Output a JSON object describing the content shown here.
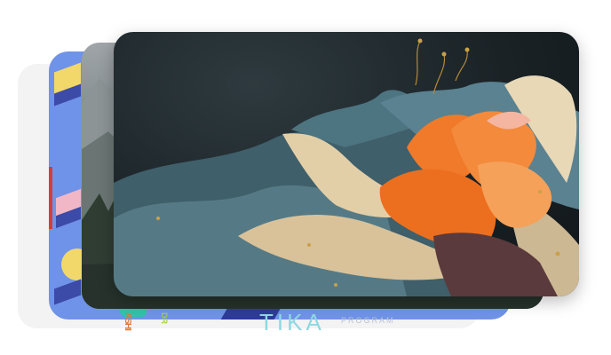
{
  "poster": {
    "bottom_word": "TIKA",
    "caption": "PROGRAM",
    "vertical_letters": "ASHI",
    "side_letters": "DR"
  },
  "colors": {
    "blue_card": "#6f93e8",
    "gray_card": "#f3f3f3",
    "art_background": "#1a2226",
    "flower_orange": "#f07a2a",
    "petal_teal": "#4f7480",
    "petal_cream": "#e8d8b6"
  }
}
